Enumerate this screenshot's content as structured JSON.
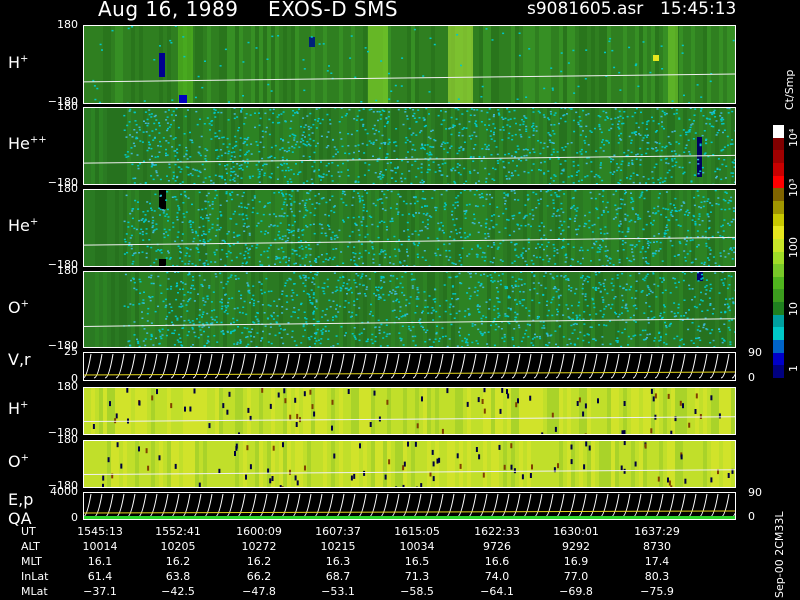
{
  "header": {
    "date": "Aug 16, 1989",
    "instrument": "EXOS-D SMS",
    "file": "s9081605.asr",
    "time": "15:45:13"
  },
  "colorbar": {
    "unit": "Ct/Smp",
    "ticks": [
      "1",
      "10",
      "100",
      "10³",
      "10⁴"
    ],
    "colors": [
      "#000080",
      "#0000c8",
      "#0064c8",
      "#00c8c8",
      "#00a0a0",
      "#208020",
      "#3c9c1e",
      "#50b41e",
      "#78c828",
      "#a0dc28",
      "#c8e628",
      "#e6e61e",
      "#c8c800",
      "#a09600",
      "#806400",
      "#ff0000",
      "#c80000",
      "#a00000",
      "#800000",
      "#ffffff"
    ]
  },
  "chart_data": [
    {
      "type": "heatmap",
      "species": "H",
      "charge": "+",
      "ylim": [
        -180,
        180
      ],
      "yticks": [
        "180",
        "−180"
      ]
    },
    {
      "type": "heatmap",
      "species": "He",
      "charge": "++",
      "ylim": [
        -180,
        180
      ],
      "yticks": [
        "180",
        "−180"
      ]
    },
    {
      "type": "heatmap",
      "species": "He",
      "charge": "+",
      "ylim": [
        -180,
        180
      ],
      "yticks": [
        "180",
        "−180"
      ]
    },
    {
      "type": "heatmap",
      "species": "O",
      "charge": "+",
      "ylim": [
        -180,
        180
      ],
      "yticks": [
        "180",
        "−180"
      ]
    },
    {
      "type": "line",
      "label": "V,r",
      "left_ticks": [
        "25",
        "0"
      ],
      "right_ticks": [
        "90",
        "0"
      ]
    },
    {
      "type": "heatmap",
      "species": "H",
      "charge": "+",
      "ylim": [
        -180,
        180
      ],
      "yticks": [
        "180",
        "−180"
      ]
    },
    {
      "type": "heatmap",
      "species": "O",
      "charge": "+",
      "ylim": [
        -180,
        180
      ],
      "yticks": [
        "180",
        "−180"
      ]
    },
    {
      "type": "line",
      "label": "E,p",
      "label2": "QA",
      "left_ticks": [
        "4000",
        "0"
      ],
      "right_ticks": [
        "90",
        "0"
      ]
    }
  ],
  "ephemeris": {
    "labels": [
      "UT",
      "ALT",
      "MLT",
      "InLat",
      "MLat"
    ],
    "columns": [
      [
        "1545:13",
        "10014",
        "16.1",
        "61.4",
        "−37.1"
      ],
      [
        "1552:41",
        "10205",
        "16.2",
        "63.8",
        "−42.5"
      ],
      [
        "1600:09",
        "10272",
        "16.2",
        "66.2",
        "−47.8"
      ],
      [
        "1607:37",
        "10215",
        "16.3",
        "68.7",
        "−53.1"
      ],
      [
        "1615:05",
        "10034",
        "16.5",
        "71.3",
        "−58.5"
      ],
      [
        "1622:33",
        "9726",
        "16.6",
        "74.0",
        "−64.1"
      ],
      [
        "1630:01",
        "9292",
        "16.9",
        "77.0",
        "−69.8"
      ],
      [
        "1637:29",
        "8730",
        "17.4",
        "80.3",
        "−75.9"
      ]
    ]
  },
  "footer": "Sep-00  2CM33L"
}
